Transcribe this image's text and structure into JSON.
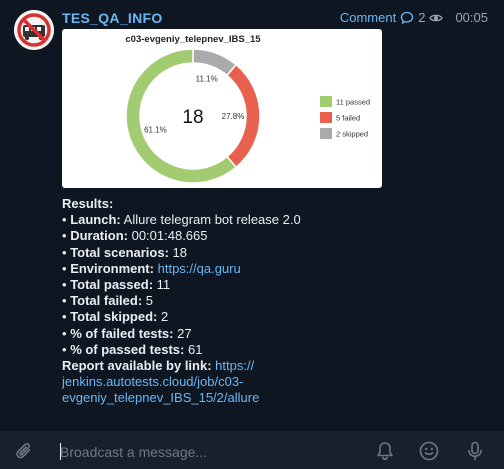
{
  "channel": {
    "name": "TES_QA_INFO",
    "comment_label": "Comment",
    "views": "2",
    "time": "00:05"
  },
  "chart_data": {
    "type": "pie",
    "title": "c03-evgeniy_telepnev_IBS_15",
    "center_label": "18",
    "slices": [
      {
        "name": "11 passed",
        "value": 11,
        "percent_label": "61.1%",
        "color": "#a3cc72"
      },
      {
        "name": "5 failed",
        "value": 5,
        "percent_label": "27.8%",
        "color": "#e8614f"
      },
      {
        "name": "2 skipped",
        "value": 2,
        "percent_label": "11.1%",
        "color": "#aaaaaa"
      }
    ],
    "legend_position": "right"
  },
  "results": {
    "heading": "Results:",
    "items": [
      {
        "label": "Launch:",
        "value": "Allure telegram bot release 2.0"
      },
      {
        "label": "Duration:",
        "value": "00:01:48.665"
      },
      {
        "label": "Total scenarios:",
        "value": "18"
      },
      {
        "label": "Environment:",
        "value": "https://qa.guru",
        "link": true
      },
      {
        "label": "Total passed:",
        "value": "11"
      },
      {
        "label": "Total failed:",
        "value": "5"
      },
      {
        "label": "Total skipped:",
        "value": "2"
      },
      {
        "label": "% of failed tests:",
        "value": "27"
      },
      {
        "label": "% of passed tests:",
        "value": "61"
      }
    ],
    "report_label": "Report available by link:",
    "report_link_lines": [
      "https://",
      "jenkins.autotests.cloud/job/c03-",
      "evgeniy_telepnev_IBS_15/2/allure"
    ],
    "bullet": "•"
  },
  "composer": {
    "placeholder": "Broadcast a message..."
  },
  "colors": {
    "background": "#0e1621",
    "composer": "#17212b",
    "accent": "#6ab7f5",
    "text": "#e9eef3"
  },
  "icons": {
    "avatar": "bug-prohibited-avatar",
    "views": "eye-icon",
    "comment": "speech-bubble-icon",
    "attach": "paperclip-icon",
    "bell": "bell-icon",
    "emoji": "smiley-icon",
    "mic": "microphone-icon"
  }
}
